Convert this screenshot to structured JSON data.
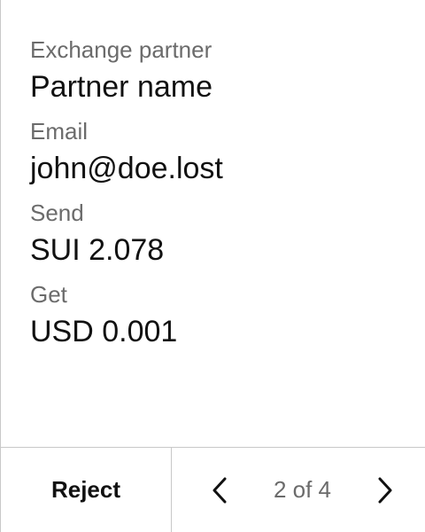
{
  "details": {
    "fields": [
      {
        "label": "Exchange partner",
        "value": "Partner name"
      },
      {
        "label": "Email",
        "value": "john@doe.lost"
      },
      {
        "label": "Send",
        "value": "SUI 2.078"
      },
      {
        "label": "Get",
        "value": "USD 0.001"
      }
    ]
  },
  "footer": {
    "reject_label": "Reject",
    "pager": {
      "text": "2 of 4",
      "prev_icon": "chevron-left-icon",
      "next_icon": "chevron-right-icon"
    }
  },
  "colors": {
    "text": "#111111",
    "muted": "#6b6b6b",
    "divider": "#c8c8c8"
  }
}
